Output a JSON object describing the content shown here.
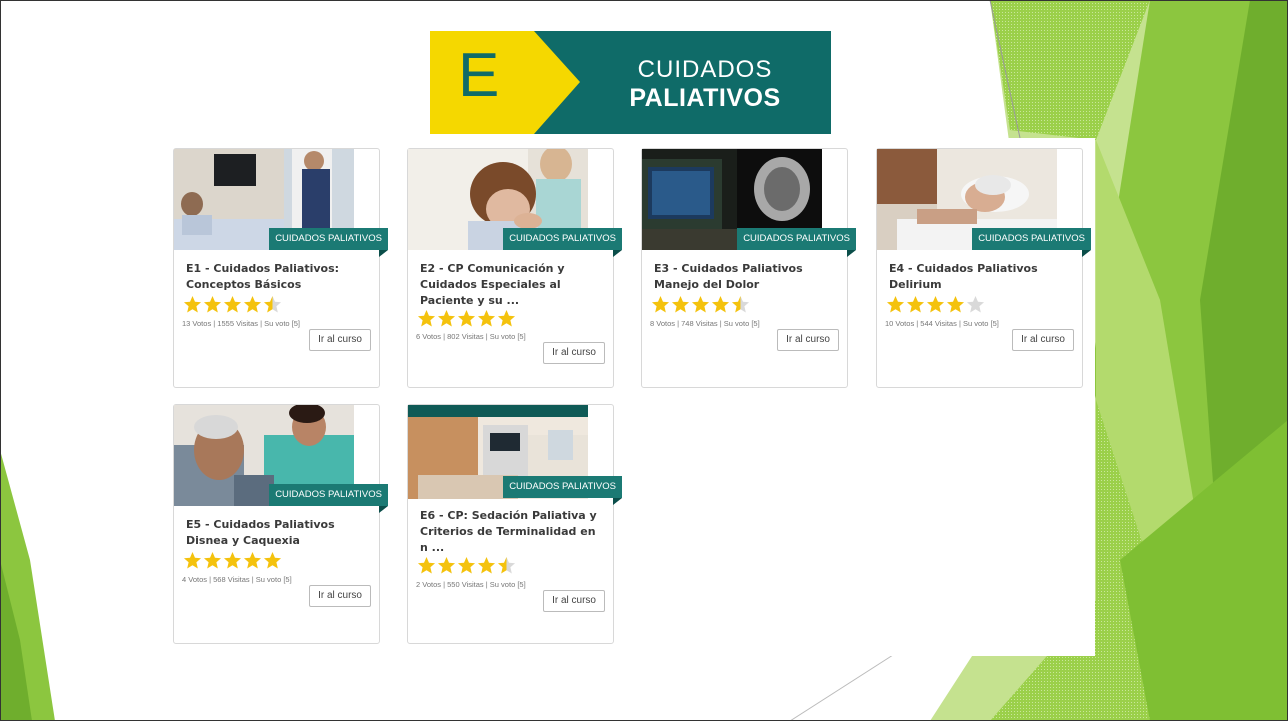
{
  "banner": {
    "letter": "E",
    "line1": "CUIDADOS",
    "line2": "PALIATIVOS"
  },
  "colors": {
    "ribbon": "#1b7a74",
    "banner_teal": "#0f6b68",
    "banner_yellow": "#f5d800",
    "star_gold": "#f4c20d",
    "star_empty": "#d9d9d9",
    "green_deco": "#8cc63f"
  },
  "courses": [
    {
      "category": "CUIDADOS PALIATIVOS",
      "title": "E1 - Cuidados Paliativos: Conceptos Básicos",
      "rating": 4.5,
      "stats": "13 Votos | 1555 Visitas | Su voto [5]",
      "button": "Ir al curso"
    },
    {
      "category": "CUIDADOS PALIATIVOS",
      "title": "E2 - CP Comunicación y Cuidados Especiales al Paciente y su ...",
      "rating": 5,
      "stats": "6 Votos | 802 Visitas | Su voto [5]",
      "button": "Ir al curso"
    },
    {
      "category": "CUIDADOS PALIATIVOS",
      "title": "E3 - Cuidados Paliativos Manejo del Dolor",
      "rating": 4.5,
      "stats": "8 Votos | 748 Visitas | Su voto [5]",
      "button": "Ir al curso"
    },
    {
      "category": "CUIDADOS PALIATIVOS",
      "title": "E4 - Cuidados Paliativos Delirium",
      "rating": 4,
      "stats": "10 Votos | 544 Visitas | Su voto [5]",
      "button": "Ir al curso"
    },
    {
      "category": "CUIDADOS PALIATIVOS",
      "title": "E5 - Cuidados Paliativos Disnea y Caquexia",
      "rating": 5,
      "stats": "4 Votos | 568 Visitas | Su voto [5]",
      "button": "Ir al curso"
    },
    {
      "category": "CUIDADOS PALIATIVOS",
      "title": "E6 - CP: Sedación Paliativa y Criterios de Terminalidad en n ...",
      "rating": 4.5,
      "stats": "2 Votos | 550 Visitas | Su voto [5]",
      "button": "Ir al curso"
    }
  ]
}
